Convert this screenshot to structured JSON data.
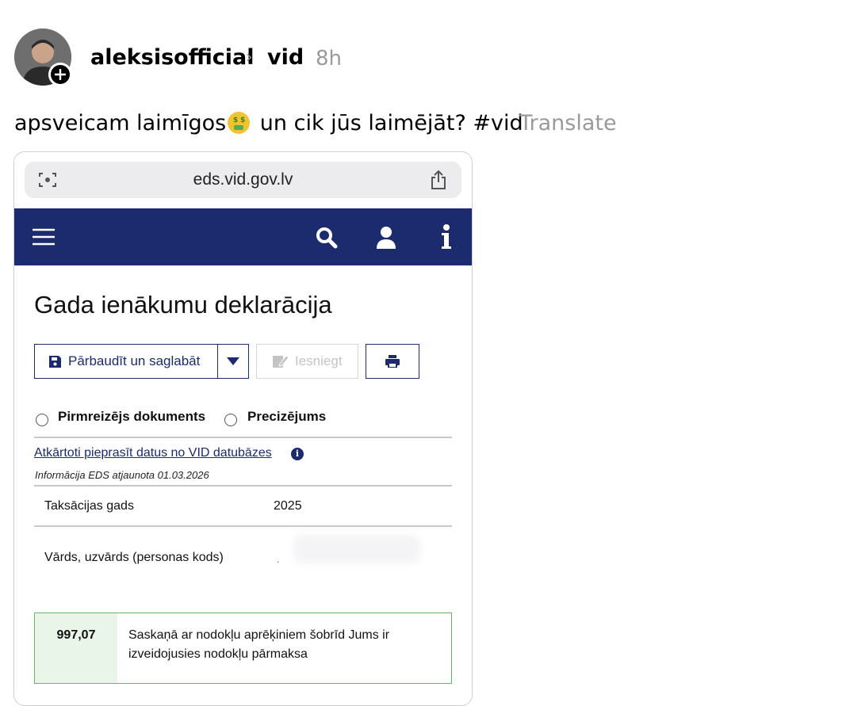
{
  "post": {
    "username": "aleksisofficial",
    "separator": "›",
    "community": "vid",
    "time": "8h",
    "caption_before": "apsveicam laimīgos",
    "caption_after": " un cik jūs laimējāt? #vid",
    "emoji": "money-mouth-face-icon",
    "translate_label": "Translate"
  },
  "browser": {
    "url": "eds.vid.gov.lv"
  },
  "nav": {
    "icons": [
      "menu-icon",
      "search-icon",
      "user-icon",
      "info-icon"
    ],
    "bg_color": "#1b2b6e"
  },
  "page": {
    "title": "Gada ienākumu deklarācija",
    "buttons": {
      "save": "Pārbaudīt un saglabāt",
      "submit": "Iesniegt"
    },
    "radios": {
      "first": "Pirmreizējs dokuments",
      "correction": "Precizējums"
    },
    "link": "Atkārtoti pieprasīt datus no VID datubāzes",
    "updated": "Informācija EDS atjaunota 01.03.2026",
    "rows": [
      {
        "label": "Taksācijas gads",
        "value": "2025"
      },
      {
        "label": "Vārds, uzvārds (personas kods)",
        "value": "."
      }
    ],
    "result": {
      "amount": "997,07",
      "text": "Saskaņā ar nodokļu aprēķiniem šobrīd Jums ir izveidojusies nodokļu pārmaksa"
    }
  },
  "colors": {
    "accent": "#1b2b6e",
    "success_border": "#6bb46b",
    "muted": "#9a9a9a"
  }
}
